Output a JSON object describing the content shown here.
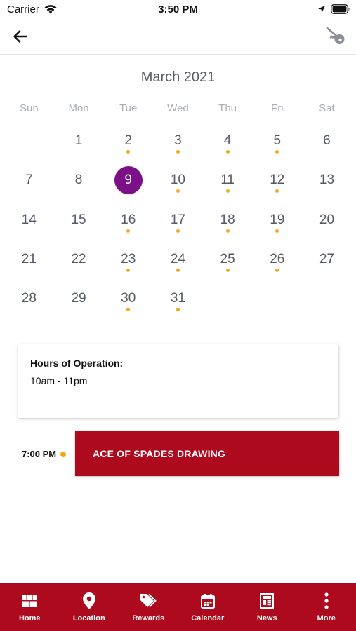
{
  "status_bar": {
    "carrier": "Carrier",
    "time": "3:50 PM"
  },
  "nav": {
    "back_icon": "back-arrow-icon",
    "key_icon": "key-icon"
  },
  "calendar": {
    "month_label": "March 2021",
    "weekdays": [
      "Sun",
      "Mon",
      "Tue",
      "Wed",
      "Thu",
      "Fri",
      "Sat"
    ],
    "selected_day": "9",
    "days": [
      {
        "label": "",
        "dot": false
      },
      {
        "label": "1",
        "dot": false
      },
      {
        "label": "2",
        "dot": true
      },
      {
        "label": "3",
        "dot": true
      },
      {
        "label": "4",
        "dot": true
      },
      {
        "label": "5",
        "dot": true
      },
      {
        "label": "6",
        "dot": false
      },
      {
        "label": "7",
        "dot": false
      },
      {
        "label": "8",
        "dot": false
      },
      {
        "label": "9",
        "dot": false
      },
      {
        "label": "10",
        "dot": true
      },
      {
        "label": "11",
        "dot": true
      },
      {
        "label": "12",
        "dot": true
      },
      {
        "label": "13",
        "dot": false
      },
      {
        "label": "14",
        "dot": false
      },
      {
        "label": "15",
        "dot": false
      },
      {
        "label": "16",
        "dot": true
      },
      {
        "label": "17",
        "dot": true
      },
      {
        "label": "18",
        "dot": true
      },
      {
        "label": "19",
        "dot": true
      },
      {
        "label": "20",
        "dot": false
      },
      {
        "label": "21",
        "dot": false
      },
      {
        "label": "22",
        "dot": false
      },
      {
        "label": "23",
        "dot": true
      },
      {
        "label": "24",
        "dot": true
      },
      {
        "label": "25",
        "dot": true
      },
      {
        "label": "26",
        "dot": true
      },
      {
        "label": "27",
        "dot": false
      },
      {
        "label": "28",
        "dot": false
      },
      {
        "label": "29",
        "dot": false
      },
      {
        "label": "30",
        "dot": true
      },
      {
        "label": "31",
        "dot": true
      }
    ]
  },
  "hours": {
    "title": "Hours of Operation:",
    "value": "10am - 11pm"
  },
  "event": {
    "time": "7:00 PM",
    "title": "ACE OF SPADES DRAWING"
  },
  "tab_bar": {
    "items": [
      {
        "label": "Home",
        "icon": "home-grid-icon"
      },
      {
        "label": "Location",
        "icon": "location-pin-icon"
      },
      {
        "label": "Rewards",
        "icon": "tag-icon"
      },
      {
        "label": "Calendar",
        "icon": "calendar-icon"
      },
      {
        "label": "News",
        "icon": "newspaper-icon"
      },
      {
        "label": "More",
        "icon": "more-vertical-icon"
      }
    ]
  },
  "colors": {
    "brand_red": "#ae0a1e",
    "selected_purple": "#7b1088",
    "event_dot": "#f0a81e"
  }
}
